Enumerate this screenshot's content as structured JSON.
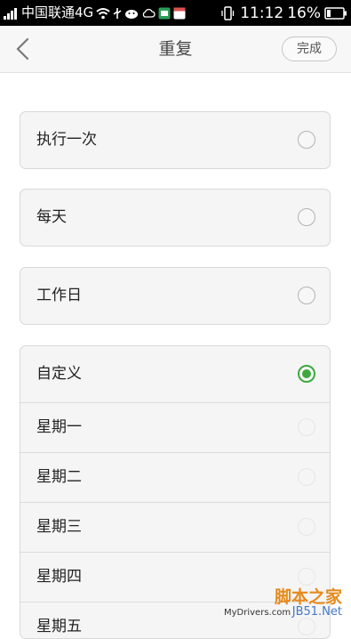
{
  "status_bar": {
    "carrier": "中国联通4G",
    "time": "11:12",
    "battery": "16%"
  },
  "header": {
    "title": "重复",
    "done_label": "完成"
  },
  "options": [
    {
      "label": "执行一次",
      "selected": false
    },
    {
      "label": "每天",
      "selected": false
    },
    {
      "label": "工作日",
      "selected": false
    },
    {
      "label": "自定义",
      "selected": true
    }
  ],
  "custom_days": [
    "星期一",
    "星期二",
    "星期三",
    "星期四",
    "星期五"
  ],
  "watermark": {
    "logo": "脚本之家",
    "url": "JB51.Net",
    "site": "MyDrivers.com"
  },
  "colors": {
    "accent": "#3ea83f",
    "status_bar": "#000000",
    "title_bar": "#f7f7f7"
  }
}
